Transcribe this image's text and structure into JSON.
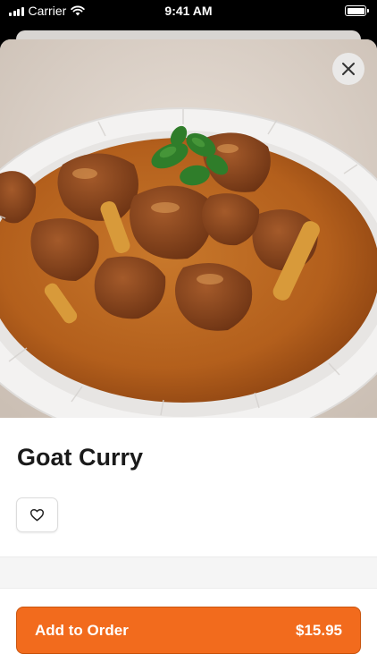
{
  "status_bar": {
    "carrier": "Carrier",
    "time": "9:41 AM"
  },
  "item": {
    "name": "Goat Curry",
    "image_alt": "goat curry photo"
  },
  "order": {
    "label": "Add to Order",
    "price": "$15.95"
  },
  "icons": {
    "close": "close-icon",
    "favorite": "heart-icon",
    "wifi": "wifi-icon",
    "signal": "signal-icon",
    "battery": "battery-icon"
  },
  "colors": {
    "accent": "#f26b1d",
    "title": "#1a1a1a"
  }
}
